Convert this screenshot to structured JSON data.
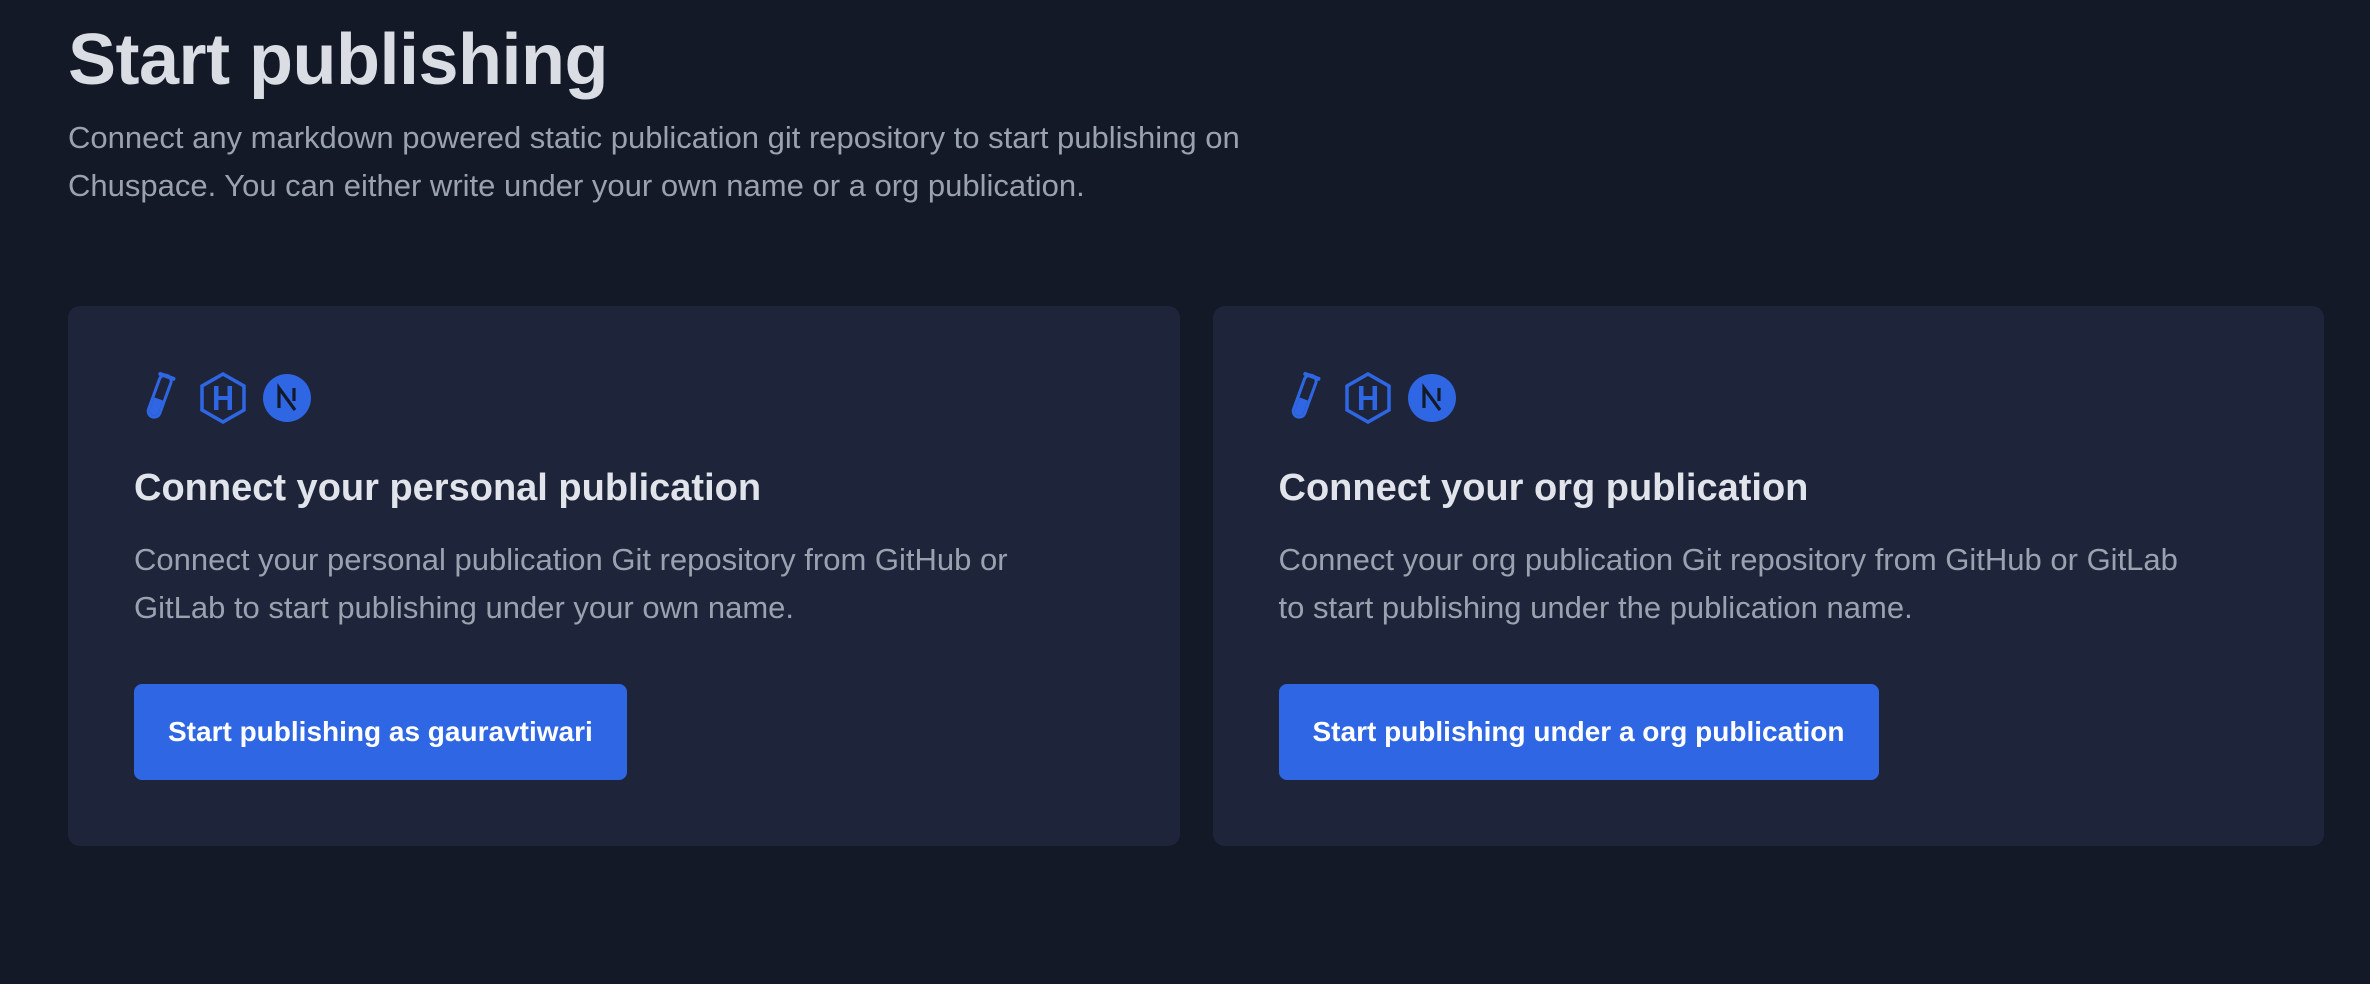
{
  "header": {
    "title": "Start publishing",
    "subtitle": "Connect any markdown powered static publication git repository to start publishing on Chuspace. You can either write under your own name or a org publication."
  },
  "cards": [
    {
      "icons": [
        "test-tube-icon",
        "hexo-icon",
        "nextjs-icon"
      ],
      "title": "Connect your personal publication",
      "description": "Connect your personal publication Git repository from GitHub or GitLab to start publishing under your own name.",
      "button_label": "Start publishing as gauravtiwari"
    },
    {
      "icons": [
        "test-tube-icon",
        "hexo-icon",
        "nextjs-icon"
      ],
      "title": "Connect your org publication",
      "description": "Connect your org publication Git repository from GitHub or GitLab to start publishing under the publication name.",
      "button_label": "Start publishing under a org publication"
    }
  ],
  "colors": {
    "background": "#131927",
    "card": "#1e253a",
    "accent": "#2f66e4",
    "title": "#dadde3",
    "muted_text": "#9aa2b0"
  }
}
